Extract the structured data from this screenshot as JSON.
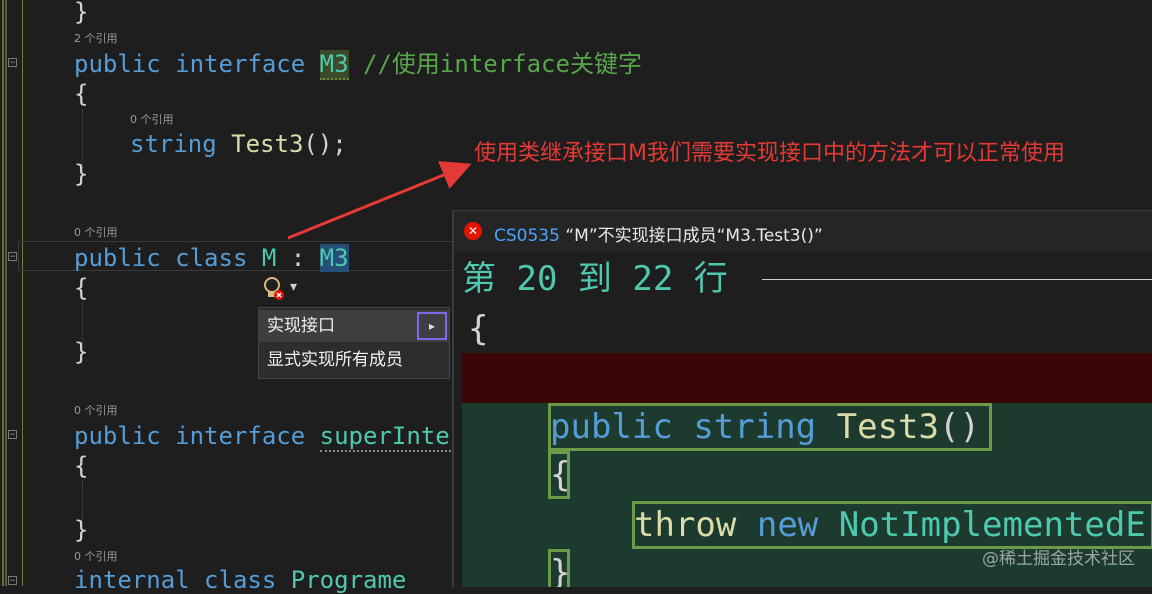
{
  "editor": {
    "lines": {
      "top_brace": "}",
      "m3_refs": "2 个引用",
      "m3_kw1": "public",
      "m3_kw2": "interface",
      "m3_name": "M3",
      "m3_comment": "//使用interface关键字",
      "open1": "{",
      "test3_refs": "0 个引用",
      "test3_type": "string",
      "test3_method": "Test3",
      "test3_rest": "();",
      "close1": "}",
      "m_refs": "0 个引用",
      "m_kw1": "public",
      "m_kw2": "class",
      "m_name": "M",
      "m_colon": " : ",
      "m_base": "M3",
      "open2": "{",
      "close2": "}",
      "super_refs": "0 个引用",
      "super_kw1": "public",
      "super_kw2": "interface",
      "super_name": "superInterf",
      "open3": "{",
      "close3": "}",
      "prog_refs": "0 个引用",
      "prog_kw1": "internal",
      "prog_kw2": "class",
      "prog_name": "Programe"
    },
    "fold_symbol": "−"
  },
  "annotation": {
    "text": "使用类继承接口M我们需要实现接口中的方法才可以正常使用",
    "color": "#e53935"
  },
  "quick_actions": {
    "icon": "lightbulb-error-icon",
    "dropdown": "▾",
    "items": [
      {
        "label": "实现接口",
        "has_submenu": true,
        "submenu_arrow": "▸"
      },
      {
        "label": "显式实现所有成员"
      }
    ]
  },
  "preview": {
    "error_icon": "✕",
    "error_code": "CS0535",
    "error_message": " “M”不实现接口成员“M3.Test3()”",
    "range": "第 20 到 22 行",
    "line_brace_open": "{",
    "kw_public": "public",
    "kw_string": "string",
    "method": "Test3",
    "parens": "()",
    "inner_brace_open": "{",
    "kw_throw": "throw",
    "kw_new": "new",
    "exception": "NotImplementedE",
    "inner_brace_close": "}"
  },
  "watermark": "@稀土掘金技术社区"
}
